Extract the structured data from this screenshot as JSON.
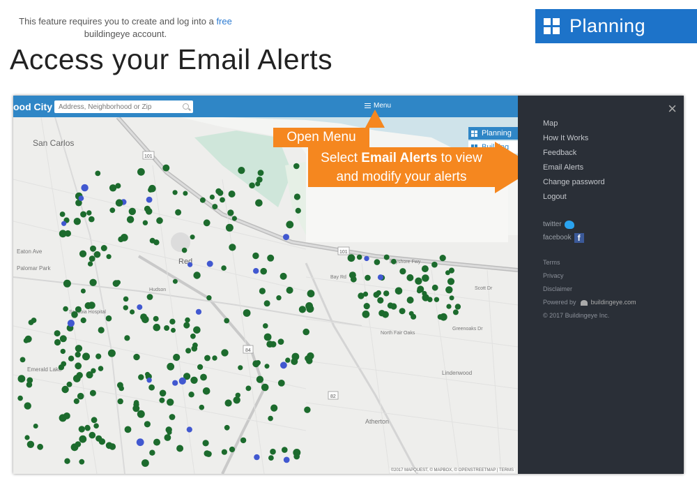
{
  "notice": {
    "line1": "This feature requires you to create and log into a",
    "link": "free",
    "line2": "buildingeye account."
  },
  "badge": {
    "label": "Planning",
    "color": "#1d73c9"
  },
  "page_title": "Access your Email Alerts",
  "app": {
    "city_fragment": "ood City",
    "search_placeholder": "Address, Neighborhood or Zip",
    "menu_label": "Menu",
    "layers": [
      {
        "label": "Planning",
        "active": true
      },
      {
        "label": "Building",
        "active": false
      }
    ],
    "map_labels": {
      "san_carlos": "San Carlos",
      "north_fair_oaks": "North Fair\nOaks",
      "atherton": "Atherton",
      "eaton_ave": "Eaton Ave",
      "palomar_park": "Palomar Park",
      "emerald_lake": "Emerald Lake",
      "lindenwood": "Lindenwood",
      "sequoia_hospital": "Sequoia Hospital",
      "greenoaks": "Greenoaks Dr",
      "scott_dr": "Scott Dr",
      "bay_rd": "Bay Rd",
      "bayshore": "Bayshore Fwy",
      "redwood": "Red",
      "hudson": "Hudson",
      "hwy101a": "101",
      "hwy101b": "101",
      "hwy82": "82",
      "hwy84": "84"
    },
    "attribution": "©2017 MAPQUEST, © MAPBOX, © OPENSTREETMAP | TERMS",
    "marker_colors": {
      "green": "#1c6b2d",
      "blue": "#4158d0"
    }
  },
  "callouts": {
    "open_menu": "Open Menu",
    "select_pre": "Select",
    "select_bold": "Email Alerts",
    "select_post": "to view",
    "select_line2": "and modify your alerts",
    "color": "#f5871f"
  },
  "sidebar": {
    "close": "×",
    "nav": [
      "Map",
      "How It Works",
      "Feedback",
      "Email Alerts",
      "Change password",
      "Logout"
    ],
    "twitter": "twitter",
    "facebook": "facebook",
    "footer": {
      "terms": "Terms",
      "privacy": "Privacy",
      "disclaimer": "Disclaimer",
      "powered_by": "Powered by",
      "powered_brand": "buildingeye.com",
      "copyright": "© 2017 Buildingeye Inc."
    }
  }
}
